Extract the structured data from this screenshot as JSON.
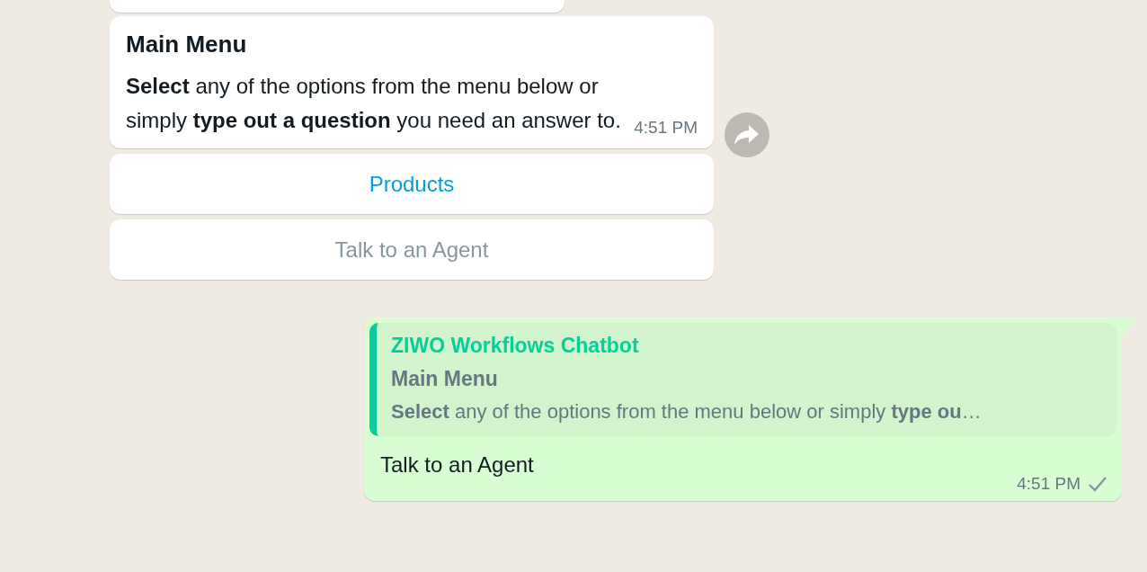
{
  "incoming": {
    "title": "Main Menu",
    "body": "**Select** any of the options from the menu below or simply **type out a question** you need an answer to.",
    "time": "4:51 PM"
  },
  "buttons": [
    {
      "label": "Products",
      "disabled": false
    },
    {
      "label": "Talk to an Agent",
      "disabled": true
    }
  ],
  "outgoing": {
    "quote": {
      "author": "ZIWO Workflows Chatbot",
      "title": "Main Menu",
      "preview": "**Select** any of the options from the menu below or simply **type ou**…"
    },
    "text": "Talk to an Agent",
    "time": "4:51 PM",
    "delivered": true
  }
}
